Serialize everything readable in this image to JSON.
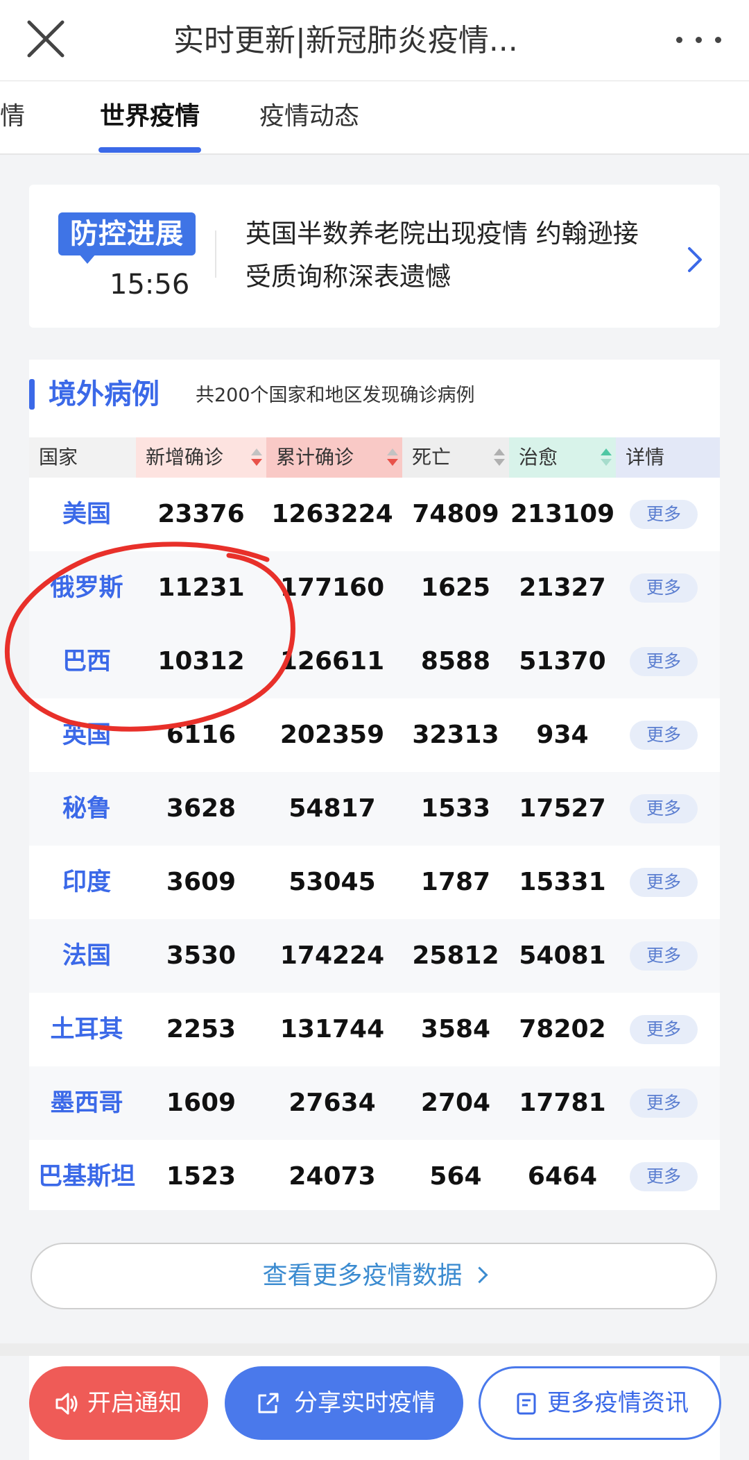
{
  "header": {
    "title": "实时更新|新冠肺炎疫情..."
  },
  "tabs": [
    {
      "label": "疫情"
    },
    {
      "label": "世界疫情",
      "active": true
    },
    {
      "label": "疫情动态"
    }
  ],
  "news": {
    "badge": "防控进展",
    "time": "15:56",
    "text": "英国半数养老院出现疫情 约翰逊接受质询称深表遗憾"
  },
  "overseas": {
    "title": "境外病例",
    "subtitle": "共200个国家和地区发现确诊病例",
    "columns": [
      "国家",
      "新增确诊",
      "累计确诊",
      "死亡",
      "治愈",
      "详情"
    ],
    "rows": [
      {
        "country": "美国",
        "new": "23376",
        "total": "1263224",
        "deaths": "74809",
        "recovered": "213109",
        "more": "更多"
      },
      {
        "country": "俄罗斯",
        "new": "11231",
        "total": "177160",
        "deaths": "1625",
        "recovered": "21327",
        "more": "更多"
      },
      {
        "country": "巴西",
        "new": "10312",
        "total": "126611",
        "deaths": "8588",
        "recovered": "51370",
        "more": "更多"
      },
      {
        "country": "英国",
        "new": "6116",
        "total": "202359",
        "deaths": "32313",
        "recovered": "934",
        "more": "更多"
      },
      {
        "country": "秘鲁",
        "new": "3628",
        "total": "54817",
        "deaths": "1533",
        "recovered": "17527",
        "more": "更多"
      },
      {
        "country": "印度",
        "new": "3609",
        "total": "53045",
        "deaths": "1787",
        "recovered": "15331",
        "more": "更多"
      },
      {
        "country": "法国",
        "new": "3530",
        "total": "174224",
        "deaths": "25812",
        "recovered": "54081",
        "more": "更多"
      },
      {
        "country": "土耳其",
        "new": "2253",
        "total": "131744",
        "deaths": "3584",
        "recovered": "78202",
        "more": "更多"
      },
      {
        "country": "墨西哥",
        "new": "1609",
        "total": "27634",
        "deaths": "2704",
        "recovered": "17781",
        "more": "更多"
      },
      {
        "country": "巴基斯坦",
        "new": "1523",
        "total": "24073",
        "deaths": "564",
        "recovered": "6464",
        "more": "更多"
      }
    ],
    "view_more": "查看更多疫情数据"
  },
  "bottom_bar": {
    "notify": "开启通知",
    "share": "分享实时疫情",
    "more_news": "更多疫情资讯"
  },
  "colors": {
    "accent": "#3b69e8",
    "notify_red": "#ef5b57",
    "share_blue": "#4a79eb",
    "annotation_red": "#e8302a",
    "header_new": "#fde3e0",
    "header_total": "#f9c9c6",
    "header_deaths": "#eeeeee",
    "header_recovered": "#d8f3ea",
    "header_detail": "#e3e8f7"
  }
}
